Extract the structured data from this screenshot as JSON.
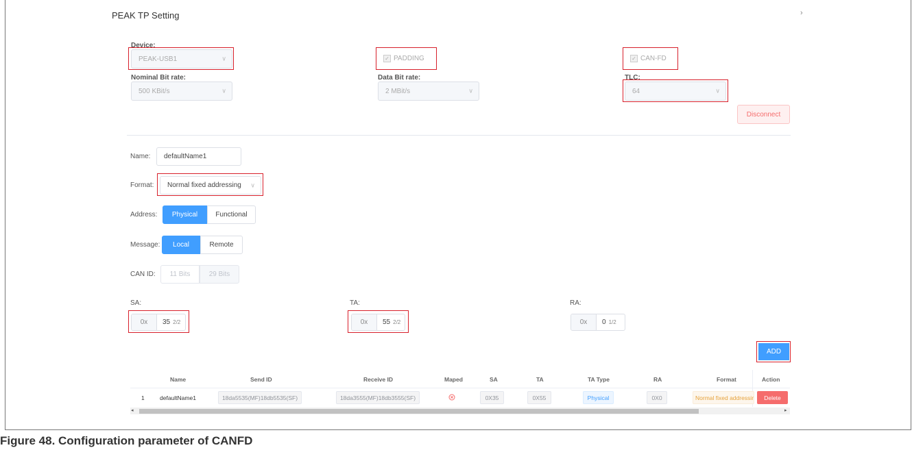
{
  "window": {
    "title": "PEAK TP Setting",
    "collapse_glyph": "›"
  },
  "device": {
    "label": "Device:",
    "value": "PEAK-USB1"
  },
  "padding": {
    "label": "PADDING",
    "checked": true
  },
  "canfd": {
    "label": "CAN-FD",
    "checked": true
  },
  "nominal_bit_rate": {
    "label": "Nominal Bit rate:",
    "value": "500 KBit/s"
  },
  "data_bit_rate": {
    "label": "Data Bit rate:",
    "value": "2 MBit/s"
  },
  "tlc": {
    "label": "TLC:",
    "value": "64"
  },
  "disconnect_label": "Disconnect",
  "form": {
    "name_label": "Name:",
    "name_value": "defaultName1",
    "format_label": "Format:",
    "format_value": "Normal fixed addressing",
    "address_label": "Address:",
    "address_options": [
      "Physical",
      "Functional"
    ],
    "message_label": "Message:",
    "message_options": [
      "Local",
      "Remote"
    ],
    "canid_label": "CAN ID:",
    "canid_options": [
      "11 Bits",
      "29 Bits"
    ],
    "sa": {
      "label": "SA:",
      "prefix": "0x",
      "value": "35",
      "count": "2/2"
    },
    "ta": {
      "label": "TA:",
      "prefix": "0x",
      "value": "55",
      "count": "2/2"
    },
    "ra": {
      "label": "RA:",
      "prefix": "0x",
      "value": "0",
      "count": "1/2"
    },
    "add_label": "ADD"
  },
  "table": {
    "headers": [
      "Name",
      "Send ID",
      "Receive ID",
      "Maped",
      "SA",
      "TA",
      "TA Type",
      "RA",
      "Format",
      "Action"
    ],
    "rows": [
      {
        "index": "1",
        "name": "defaultName1",
        "send_id": "18da5535(MF)18db5535(SF)",
        "receive_id": "18da3555(MF)18db3555(SF)",
        "maped_icon": "error-circle-icon",
        "sa": "0X35",
        "ta": "0X55",
        "ta_type": "Physical",
        "ra": "0X0",
        "format": "Normal fixed addressing",
        "action": "Delete"
      }
    ]
  },
  "caption": "Figure 48.  Configuration parameter of CANFD",
  "colors": {
    "primary": "#409eff",
    "danger": "#f56c6c",
    "highlight": "#d71f2a"
  }
}
